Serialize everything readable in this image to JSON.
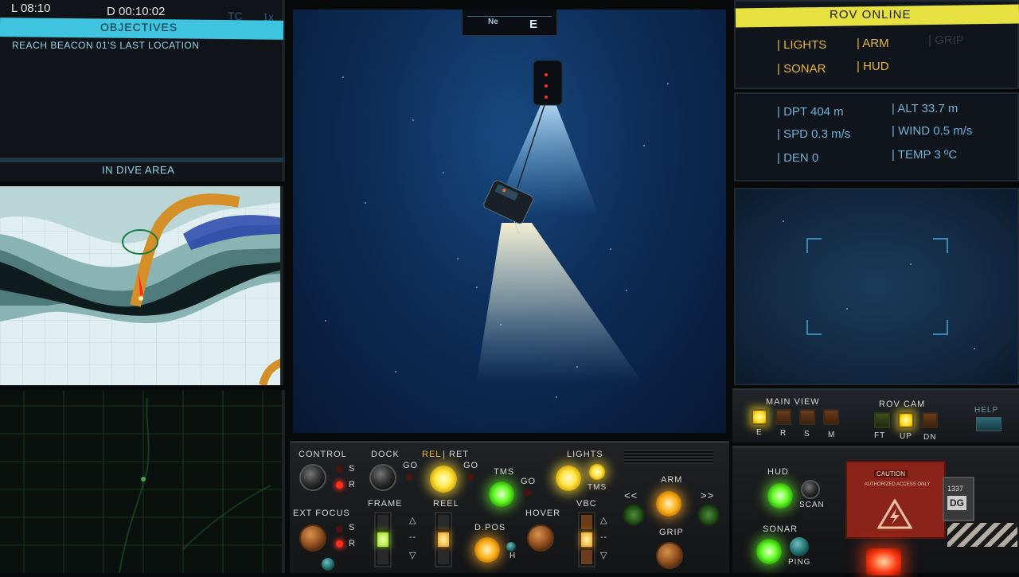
{
  "top_left": {
    "local_time": "L 08:10",
    "dive_time": "D 00:10:02",
    "tc": "TC",
    "speed": "1x"
  },
  "objectives": {
    "header": "OBJECTIVES",
    "items": [
      "REACH BEACON 01'S LAST LOCATION"
    ],
    "status": "IN DIVE AREA"
  },
  "compass": {
    "marks": [
      "Ne",
      "E"
    ]
  },
  "rov": {
    "status": "ROV ONLINE",
    "systems": [
      "LIGHTS",
      "ARM",
      "GRIP",
      "SONAR",
      "HUD"
    ],
    "stats": {
      "dpt": "DPT 404 m",
      "alt": "ALT 33.7 m",
      "spd": "SPD 0.3 m/s",
      "wind": "WIND 0.5 m/s",
      "den": "DEN  0",
      "temp": "TEMP 3 ºC"
    }
  },
  "view_panel": {
    "main_view_label": "MAIN VIEW",
    "main_view_keys": [
      "E",
      "R",
      "S",
      "M"
    ],
    "rov_cam_label": "ROV CAM",
    "rov_cam_keys": [
      "FT",
      "UP",
      "DN"
    ],
    "help_label": "HELP"
  },
  "console": {
    "control": "CONTROL",
    "dock": "DOCK",
    "rel": "REL",
    "ret": "RET",
    "sep": "|",
    "lights": "LIGHTS",
    "go": "GO",
    "s": "S",
    "r": "R",
    "tms": "TMS",
    "ext_focus": "EXT FOCUS",
    "frame": "FRAME",
    "reel": "REEL",
    "dpos": "D.POS",
    "h": "H",
    "hover": "HOVER",
    "vbc": "VBC",
    "arm": "ARM",
    "grip": "GRIP",
    "left_arrows": "<<",
    "right_arrows": ">>",
    "up": "△",
    "dash": "--",
    "down": "▽"
  },
  "right_console": {
    "hud": "HUD",
    "scan": "SCAN",
    "sonar": "SONAR",
    "ping": "PING",
    "caution_title": "CAUTION",
    "caution_text": "AUTHORIZED ACCESS ONLY",
    "badge_number": "1337",
    "badge_code": "DG"
  },
  "colors": {
    "accent_cyan": "#3fc4e0",
    "hud_yellow": "#e8b53a",
    "rov_yellow": "#e6e040",
    "stat_blue": "#6fb0d8",
    "water": "#0d2a55"
  }
}
